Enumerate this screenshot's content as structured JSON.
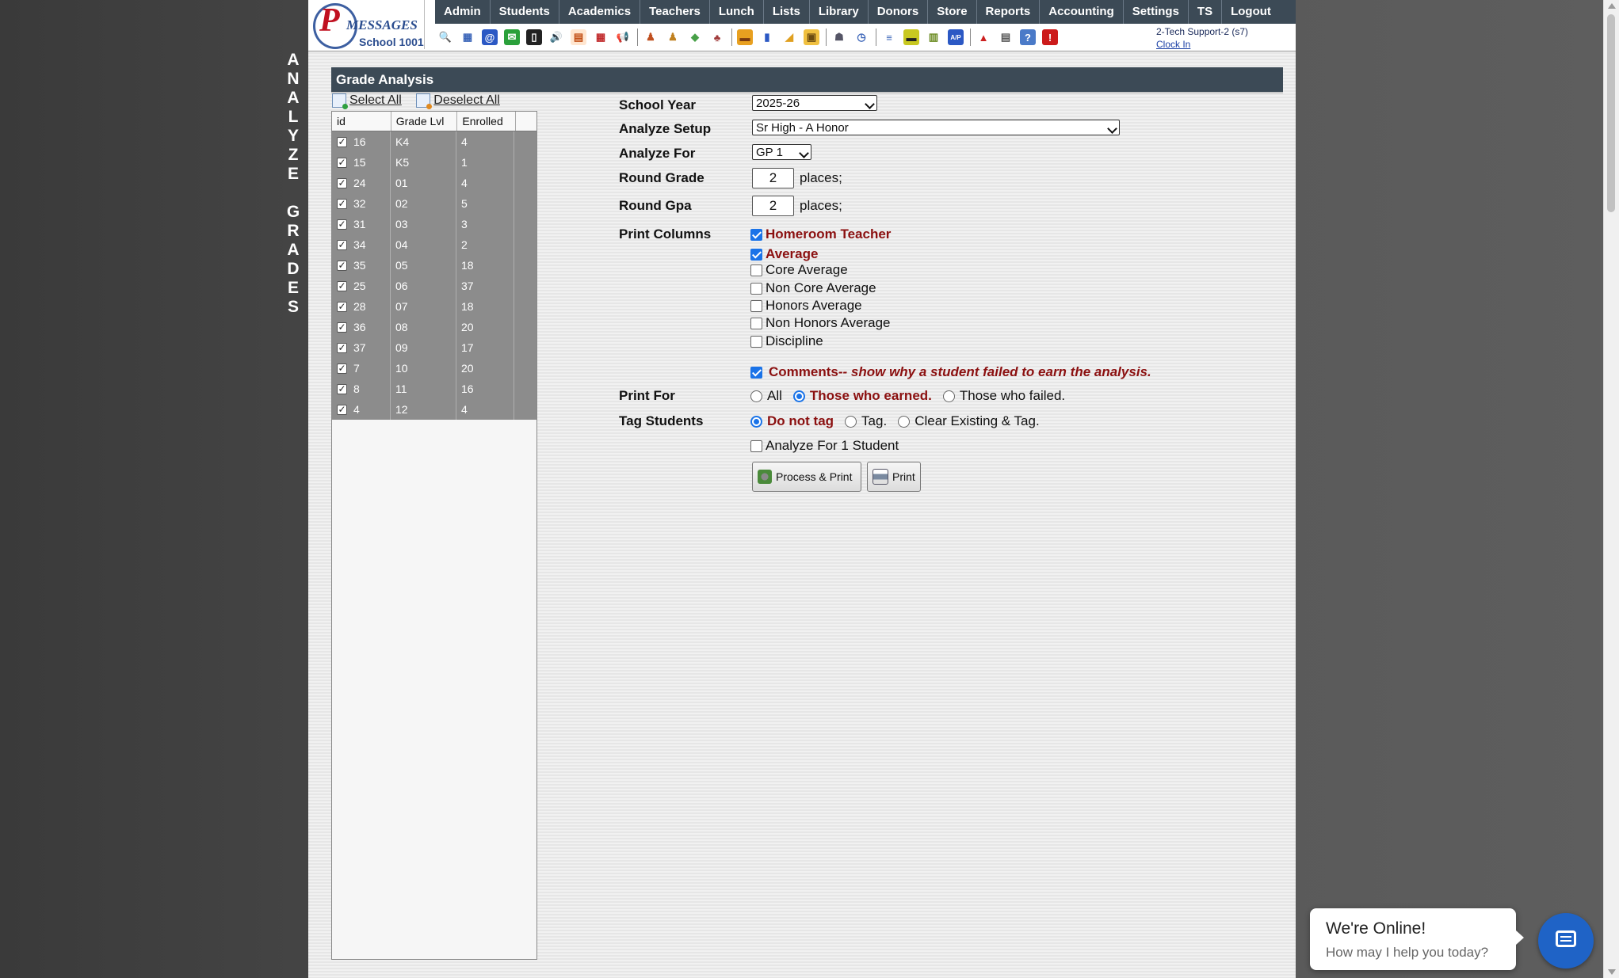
{
  "logo": {
    "mark": "P",
    "word": "MESSAGES",
    "school": "School 1001"
  },
  "menu": [
    "Admin",
    "Students",
    "Academics",
    "Teachers",
    "Lunch",
    "Lists",
    "Library",
    "Donors",
    "Store",
    "Reports",
    "Accounting",
    "Settings",
    "TS",
    "Logout"
  ],
  "toolbar_icons": [
    {
      "name": "search-icon",
      "glyph": "🔍",
      "bg": "#ffffff",
      "fg": "#3a64b8"
    },
    {
      "name": "table-icon",
      "glyph": "▦",
      "bg": "#ffffff",
      "fg": "#3a64b8"
    },
    {
      "name": "email-icon",
      "glyph": "@",
      "bg": "#2b58c4",
      "fg": "#ffffff"
    },
    {
      "name": "chat-icon",
      "glyph": "✉",
      "bg": "#2aa03a",
      "fg": "#ffffff"
    },
    {
      "name": "phone-icon",
      "glyph": "▯",
      "bg": "#222222",
      "fg": "#ffffff"
    },
    {
      "name": "speaker-icon",
      "glyph": "🔊",
      "bg": "#ffffff",
      "fg": "#cc3a3a"
    },
    {
      "name": "form-icon",
      "glyph": "▤",
      "bg": "#ffe6d0",
      "fg": "#c04a10"
    },
    {
      "name": "calendar-icon",
      "glyph": "▦",
      "bg": "#ffffff",
      "fg": "#c0282a"
    },
    {
      "name": "megaphone-icon",
      "glyph": "📢",
      "bg": "#ffffff",
      "fg": "#d1462a"
    },
    {
      "name": "separator"
    },
    {
      "name": "student-icon",
      "glyph": "♟",
      "bg": "#ffffff",
      "fg": "#c05020"
    },
    {
      "name": "teacher-icon",
      "glyph": "♟",
      "bg": "#ffffff",
      "fg": "#c08020"
    },
    {
      "name": "money-icon",
      "glyph": "◆",
      "bg": "#ffffff",
      "fg": "#48a048"
    },
    {
      "name": "group-icon",
      "glyph": "♣",
      "bg": "#ffffff",
      "fg": "#a03a3a"
    },
    {
      "name": "separator"
    },
    {
      "name": "lunch-icon",
      "glyph": "▬",
      "bg": "#e8a020",
      "fg": "#7a3a10"
    },
    {
      "name": "book-icon",
      "glyph": "▮",
      "bg": "#ffffff",
      "fg": "#2b58c4"
    },
    {
      "name": "donate-icon",
      "glyph": "◢",
      "bg": "#ffffff",
      "fg": "#e0a020"
    },
    {
      "name": "store-icon",
      "glyph": "▣",
      "bg": "#f0c040",
      "fg": "#6a4a10"
    },
    {
      "name": "separator"
    },
    {
      "name": "user-icon",
      "glyph": "☗",
      "bg": "#ffffff",
      "fg": "#556"
    },
    {
      "name": "clock-icon",
      "glyph": "◷",
      "bg": "#ffffff",
      "fg": "#3a64b8"
    },
    {
      "name": "separator"
    },
    {
      "name": "list-icon",
      "glyph": "≡",
      "bg": "#ffffff",
      "fg": "#3a64b8"
    },
    {
      "name": "card-icon",
      "glyph": "▬",
      "bg": "#c8c820",
      "fg": "#222222"
    },
    {
      "name": "printer-icon",
      "glyph": "▥",
      "bg": "#ffffff",
      "fg": "#6a8a20"
    },
    {
      "name": "ap-icon",
      "glyph": "A/P",
      "bg": "#2b58c4",
      "fg": "#ffffff"
    },
    {
      "name": "separator"
    },
    {
      "name": "pdf-icon",
      "glyph": "▲",
      "bg": "#ffffff",
      "fg": "#cc2020"
    },
    {
      "name": "stack-icon",
      "glyph": "▤",
      "bg": "#ffffff",
      "fg": "#555555"
    },
    {
      "name": "help-icon",
      "glyph": "?",
      "bg": "#4a7ac8",
      "fg": "#ffffff"
    },
    {
      "name": "power-icon",
      "glyph": "!",
      "bg": "#cc1a1a",
      "fg": "#ffffff"
    }
  ],
  "user": {
    "name": "2-Tech Support-2 (s7)",
    "clock_in": "Clock In"
  },
  "side_title": [
    "A",
    "N",
    "A",
    "L",
    "Y",
    "Z",
    "E",
    "",
    "G",
    "R",
    "A",
    "D",
    "E",
    "S"
  ],
  "section_title": "Grade Analysis",
  "select_all": "Select All",
  "deselect_all": "Deselect All",
  "grade_table": {
    "headers": [
      "id",
      "Grade Lvl",
      "Enrolled"
    ],
    "rows": [
      {
        "id": "16",
        "grade": "K4",
        "enrolled": "4"
      },
      {
        "id": "15",
        "grade": "K5",
        "enrolled": "1"
      },
      {
        "id": "24",
        "grade": "01",
        "enrolled": "4"
      },
      {
        "id": "32",
        "grade": "02",
        "enrolled": "5"
      },
      {
        "id": "31",
        "grade": "03",
        "enrolled": "3"
      },
      {
        "id": "34",
        "grade": "04",
        "enrolled": "2"
      },
      {
        "id": "35",
        "grade": "05",
        "enrolled": "18"
      },
      {
        "id": "25",
        "grade": "06",
        "enrolled": "37"
      },
      {
        "id": "28",
        "grade": "07",
        "enrolled": "18"
      },
      {
        "id": "36",
        "grade": "08",
        "enrolled": "20"
      },
      {
        "id": "37",
        "grade": "09",
        "enrolled": "17"
      },
      {
        "id": "7",
        "grade": "10",
        "enrolled": "20"
      },
      {
        "id": "8",
        "grade": "11",
        "enrolled": "16"
      },
      {
        "id": "4",
        "grade": "12",
        "enrolled": "4"
      }
    ]
  },
  "form": {
    "school_year_label": "School Year",
    "school_year_value": "2025-26",
    "analyze_setup_label": "Analyze Setup",
    "analyze_setup_value": "Sr High - A Honor",
    "analyze_for_label": "Analyze For",
    "analyze_for_value": "GP 1",
    "round_grade_label": "Round Grade",
    "round_grade_value": "2",
    "round_gpa_label": "Round Gpa",
    "round_gpa_value": "2",
    "places_text": "places;",
    "print_columns_label": "Print Columns",
    "columns": [
      {
        "label": "Homeroom Teacher",
        "checked": true
      },
      {
        "label": "Average",
        "checked": true
      },
      {
        "label": "Core Average",
        "checked": false
      },
      {
        "label": "Non Core Average",
        "checked": false
      },
      {
        "label": "Honors Average",
        "checked": false
      },
      {
        "label": "Non Honors Average",
        "checked": false
      },
      {
        "label": "Discipline",
        "checked": false
      }
    ],
    "comments_label": "Comments",
    "comments_note": "-- show why a student failed to earn the analysis.",
    "print_for_label": "Print For",
    "print_for_options": [
      "All",
      "Those who earned.",
      "Those who failed."
    ],
    "print_for_selected": 1,
    "tag_students_label": "Tag Students",
    "tag_options": [
      "Do not tag",
      "Tag.",
      "Clear Existing & Tag."
    ],
    "tag_selected": 0,
    "analyze_one": "Analyze For 1 Student",
    "process_print": "Process & Print",
    "print": "Print"
  },
  "chat": {
    "title": "We're Online!",
    "subtitle": "How may I help you today?"
  },
  "colors": {
    "nav": "#3c4a56",
    "accent_red": "#8b1010",
    "check_blue": "#1a73e8",
    "chat_blue": "#1f63c6"
  }
}
